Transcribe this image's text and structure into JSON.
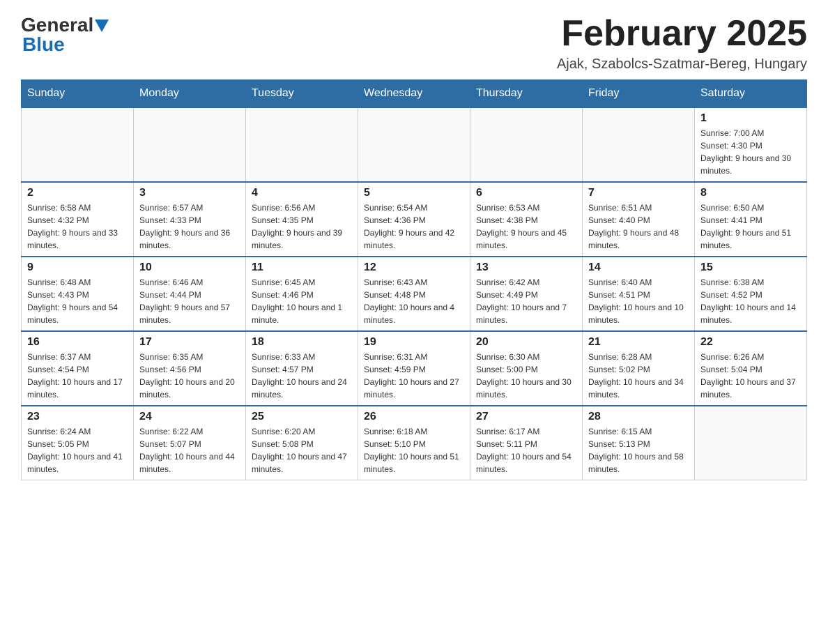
{
  "header": {
    "logo_dark": "General",
    "logo_blue": "Blue",
    "month_title": "February 2025",
    "location": "Ajak, Szabolcs-Szatmar-Bereg, Hungary"
  },
  "days_of_week": [
    "Sunday",
    "Monday",
    "Tuesday",
    "Wednesday",
    "Thursday",
    "Friday",
    "Saturday"
  ],
  "weeks": [
    [
      {
        "day": "",
        "info": ""
      },
      {
        "day": "",
        "info": ""
      },
      {
        "day": "",
        "info": ""
      },
      {
        "day": "",
        "info": ""
      },
      {
        "day": "",
        "info": ""
      },
      {
        "day": "",
        "info": ""
      },
      {
        "day": "1",
        "info": "Sunrise: 7:00 AM\nSunset: 4:30 PM\nDaylight: 9 hours and 30 minutes."
      }
    ],
    [
      {
        "day": "2",
        "info": "Sunrise: 6:58 AM\nSunset: 4:32 PM\nDaylight: 9 hours and 33 minutes."
      },
      {
        "day": "3",
        "info": "Sunrise: 6:57 AM\nSunset: 4:33 PM\nDaylight: 9 hours and 36 minutes."
      },
      {
        "day": "4",
        "info": "Sunrise: 6:56 AM\nSunset: 4:35 PM\nDaylight: 9 hours and 39 minutes."
      },
      {
        "day": "5",
        "info": "Sunrise: 6:54 AM\nSunset: 4:36 PM\nDaylight: 9 hours and 42 minutes."
      },
      {
        "day": "6",
        "info": "Sunrise: 6:53 AM\nSunset: 4:38 PM\nDaylight: 9 hours and 45 minutes."
      },
      {
        "day": "7",
        "info": "Sunrise: 6:51 AM\nSunset: 4:40 PM\nDaylight: 9 hours and 48 minutes."
      },
      {
        "day": "8",
        "info": "Sunrise: 6:50 AM\nSunset: 4:41 PM\nDaylight: 9 hours and 51 minutes."
      }
    ],
    [
      {
        "day": "9",
        "info": "Sunrise: 6:48 AM\nSunset: 4:43 PM\nDaylight: 9 hours and 54 minutes."
      },
      {
        "day": "10",
        "info": "Sunrise: 6:46 AM\nSunset: 4:44 PM\nDaylight: 9 hours and 57 minutes."
      },
      {
        "day": "11",
        "info": "Sunrise: 6:45 AM\nSunset: 4:46 PM\nDaylight: 10 hours and 1 minute."
      },
      {
        "day": "12",
        "info": "Sunrise: 6:43 AM\nSunset: 4:48 PM\nDaylight: 10 hours and 4 minutes."
      },
      {
        "day": "13",
        "info": "Sunrise: 6:42 AM\nSunset: 4:49 PM\nDaylight: 10 hours and 7 minutes."
      },
      {
        "day": "14",
        "info": "Sunrise: 6:40 AM\nSunset: 4:51 PM\nDaylight: 10 hours and 10 minutes."
      },
      {
        "day": "15",
        "info": "Sunrise: 6:38 AM\nSunset: 4:52 PM\nDaylight: 10 hours and 14 minutes."
      }
    ],
    [
      {
        "day": "16",
        "info": "Sunrise: 6:37 AM\nSunset: 4:54 PM\nDaylight: 10 hours and 17 minutes."
      },
      {
        "day": "17",
        "info": "Sunrise: 6:35 AM\nSunset: 4:56 PM\nDaylight: 10 hours and 20 minutes."
      },
      {
        "day": "18",
        "info": "Sunrise: 6:33 AM\nSunset: 4:57 PM\nDaylight: 10 hours and 24 minutes."
      },
      {
        "day": "19",
        "info": "Sunrise: 6:31 AM\nSunset: 4:59 PM\nDaylight: 10 hours and 27 minutes."
      },
      {
        "day": "20",
        "info": "Sunrise: 6:30 AM\nSunset: 5:00 PM\nDaylight: 10 hours and 30 minutes."
      },
      {
        "day": "21",
        "info": "Sunrise: 6:28 AM\nSunset: 5:02 PM\nDaylight: 10 hours and 34 minutes."
      },
      {
        "day": "22",
        "info": "Sunrise: 6:26 AM\nSunset: 5:04 PM\nDaylight: 10 hours and 37 minutes."
      }
    ],
    [
      {
        "day": "23",
        "info": "Sunrise: 6:24 AM\nSunset: 5:05 PM\nDaylight: 10 hours and 41 minutes."
      },
      {
        "day": "24",
        "info": "Sunrise: 6:22 AM\nSunset: 5:07 PM\nDaylight: 10 hours and 44 minutes."
      },
      {
        "day": "25",
        "info": "Sunrise: 6:20 AM\nSunset: 5:08 PM\nDaylight: 10 hours and 47 minutes."
      },
      {
        "day": "26",
        "info": "Sunrise: 6:18 AM\nSunset: 5:10 PM\nDaylight: 10 hours and 51 minutes."
      },
      {
        "day": "27",
        "info": "Sunrise: 6:17 AM\nSunset: 5:11 PM\nDaylight: 10 hours and 54 minutes."
      },
      {
        "day": "28",
        "info": "Sunrise: 6:15 AM\nSunset: 5:13 PM\nDaylight: 10 hours and 58 minutes."
      },
      {
        "day": "",
        "info": ""
      }
    ]
  ]
}
